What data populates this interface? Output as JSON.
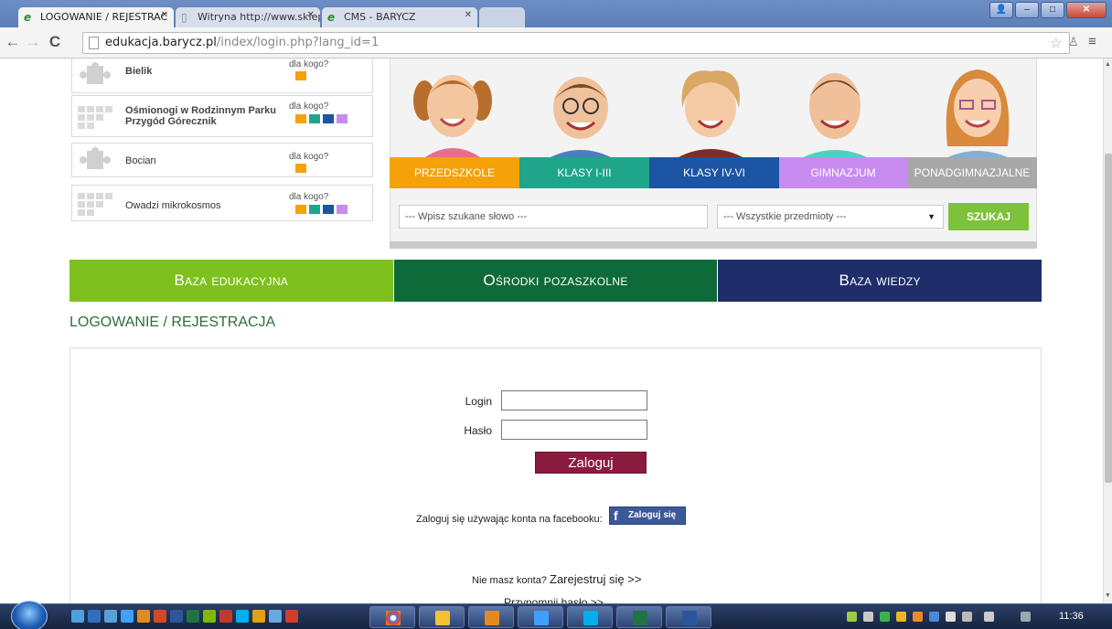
{
  "browser": {
    "tabs": [
      {
        "title": "LOGOWANIE / REJESTRAC",
        "active": true
      },
      {
        "title": "Witryna http://www.sklep",
        "active": false
      },
      {
        "title": "CMS - BARYCZ",
        "active": false
      }
    ],
    "url_host": "edukacja.barycz.pl",
    "url_path": "/index/login.php?lang_id=1"
  },
  "colors": {
    "orange": "#f5a10a",
    "teal": "#1fa58a",
    "blue": "#1b55a3",
    "purple": "#c88cf0",
    "gray": "#a8a8a8",
    "nav_green": "#7ec11f",
    "nav_darkgreen": "#0f6a3a",
    "nav_navy": "#1f2d6b",
    "login_btn": "#8b1b3e",
    "facebook": "#3b5998"
  },
  "programs": [
    {
      "title": "Bielik",
      "for_who": "dla kogo?",
      "dots": [
        "orange"
      ]
    },
    {
      "title": "Ośmionogi w Rodzinnym Parku Przygód Górecznik",
      "for_who": "dla kogo?",
      "dots": [
        "orange",
        "teal",
        "blue",
        "purple"
      ]
    },
    {
      "title": "Bocian",
      "for_who": "dla kogo?",
      "dots": [
        "orange"
      ]
    },
    {
      "title": "Owadzi mikrokosmos",
      "for_who": "dla kogo?",
      "dots": [
        "orange",
        "teal",
        "blue",
        "purple"
      ]
    }
  ],
  "categories": [
    {
      "label": "PRZEDSZKOLE",
      "color": "orange"
    },
    {
      "label": "KLASY I-III",
      "color": "teal"
    },
    {
      "label": "KLASY IV-VI",
      "color": "blue"
    },
    {
      "label": "GIMNAZJUM",
      "color": "purple"
    },
    {
      "label": "PONADGIMNAZJALNE",
      "color": "gray"
    }
  ],
  "search": {
    "placeholder": "--- Wpisz szukane słowo ---",
    "subject_selected": "--- Wszystkie przedmioty ---",
    "button": "SZUKAJ"
  },
  "main_nav": [
    {
      "label": "Baza edukacyjna",
      "color": "nav_green"
    },
    {
      "label": "Ośrodki pozaszkolne",
      "color": "nav_darkgreen"
    },
    {
      "label": "Baza wiedzy",
      "color": "nav_navy"
    }
  ],
  "page_title": "LOGOWANIE / REJESTRACJA",
  "login": {
    "login_label": "Login",
    "password_label": "Hasło",
    "login_value": "",
    "password_value": "",
    "submit": "Zaloguj",
    "facebook_text": "Zaloguj się używając konta na facebooku:",
    "facebook_button": "Zaloguj się",
    "register_prefix": "Nie masz konta?",
    "register_link": "Zarejestruj się >>",
    "remind_link": "Przypomnij hasło >>"
  },
  "taskbar": {
    "clock": "11:36"
  }
}
